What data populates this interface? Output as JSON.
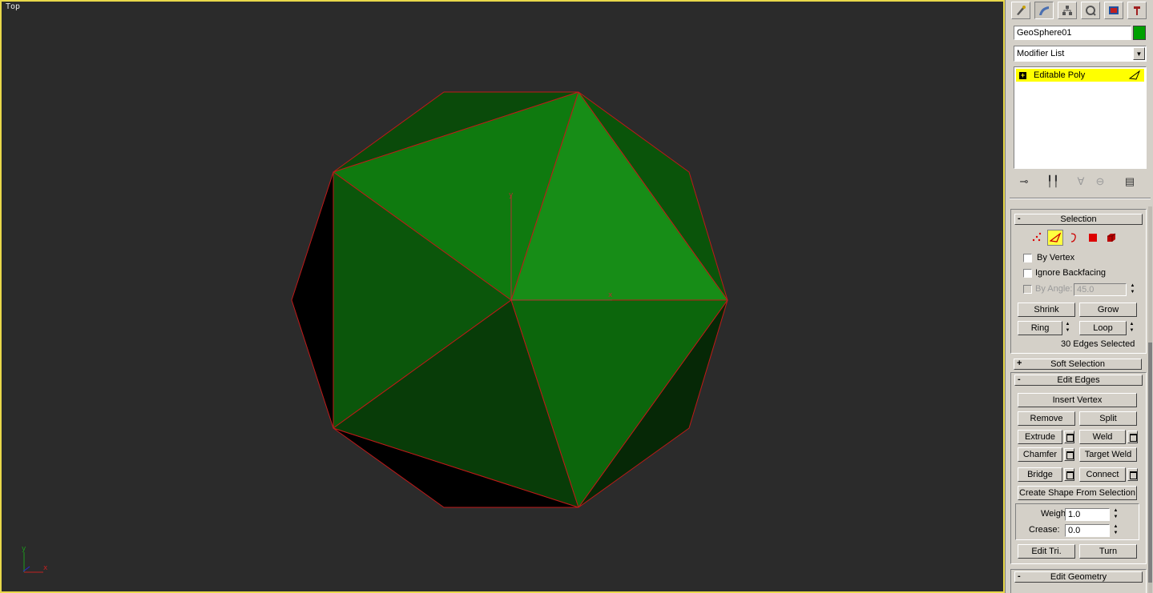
{
  "viewport": {
    "label": "Top",
    "axis_x": "x",
    "axis_y": "y",
    "gizmo_x": "x",
    "gizmo_y": "y"
  },
  "object": {
    "name": "GeoSphere01",
    "color": "#00a000"
  },
  "modifier_list": {
    "label": "Modifier List"
  },
  "stack": {
    "items": [
      {
        "label": "Editable Poly",
        "expander": "+"
      }
    ]
  },
  "command_tabs": [
    "create-icon",
    "modify-icon",
    "hierarchy-icon",
    "motion-icon",
    "display-icon",
    "utilities-icon"
  ],
  "stack_tools": [
    "pin-stack-icon",
    "show-end-result-icon",
    "make-unique-icon",
    "remove-modifier-icon",
    "configure-sets-icon"
  ],
  "selection": {
    "title": "Selection",
    "collapse_sign": "-",
    "levels": [
      "vertex-icon",
      "edge-icon",
      "border-icon",
      "polygon-icon",
      "element-icon"
    ],
    "by_vertex": "By Vertex",
    "ignore_backfacing": "Ignore Backfacing",
    "by_angle": "By Angle:",
    "by_angle_value": "45.0",
    "shrink": "Shrink",
    "grow": "Grow",
    "ring": "Ring",
    "loop": "Loop",
    "status": "30 Edges Selected"
  },
  "soft_selection": {
    "title": "Soft Selection",
    "collapse_sign": "+"
  },
  "edit_edges": {
    "title": "Edit Edges",
    "collapse_sign": "-",
    "insert_vertex": "Insert Vertex",
    "remove": "Remove",
    "split": "Split",
    "extrude": "Extrude",
    "weld": "Weld",
    "chamfer": "Chamfer",
    "target_weld": "Target Weld",
    "bridge": "Bridge",
    "connect": "Connect",
    "create_shape": "Create Shape From Selection",
    "weight_label": "Weight:",
    "weight_value": "1.0",
    "crease_label": "Crease:",
    "crease_value": "0.0",
    "edit_tri": "Edit Tri.",
    "turn": "Turn"
  },
  "edit_geometry": {
    "title": "Edit Geometry",
    "collapse_sign": "-"
  },
  "colors": {
    "viewport_bg": "#2b2b2b",
    "viewport_border": "#e8d84a",
    "edge_selected": "#d02020",
    "stack_highlight": "#ffff00"
  }
}
